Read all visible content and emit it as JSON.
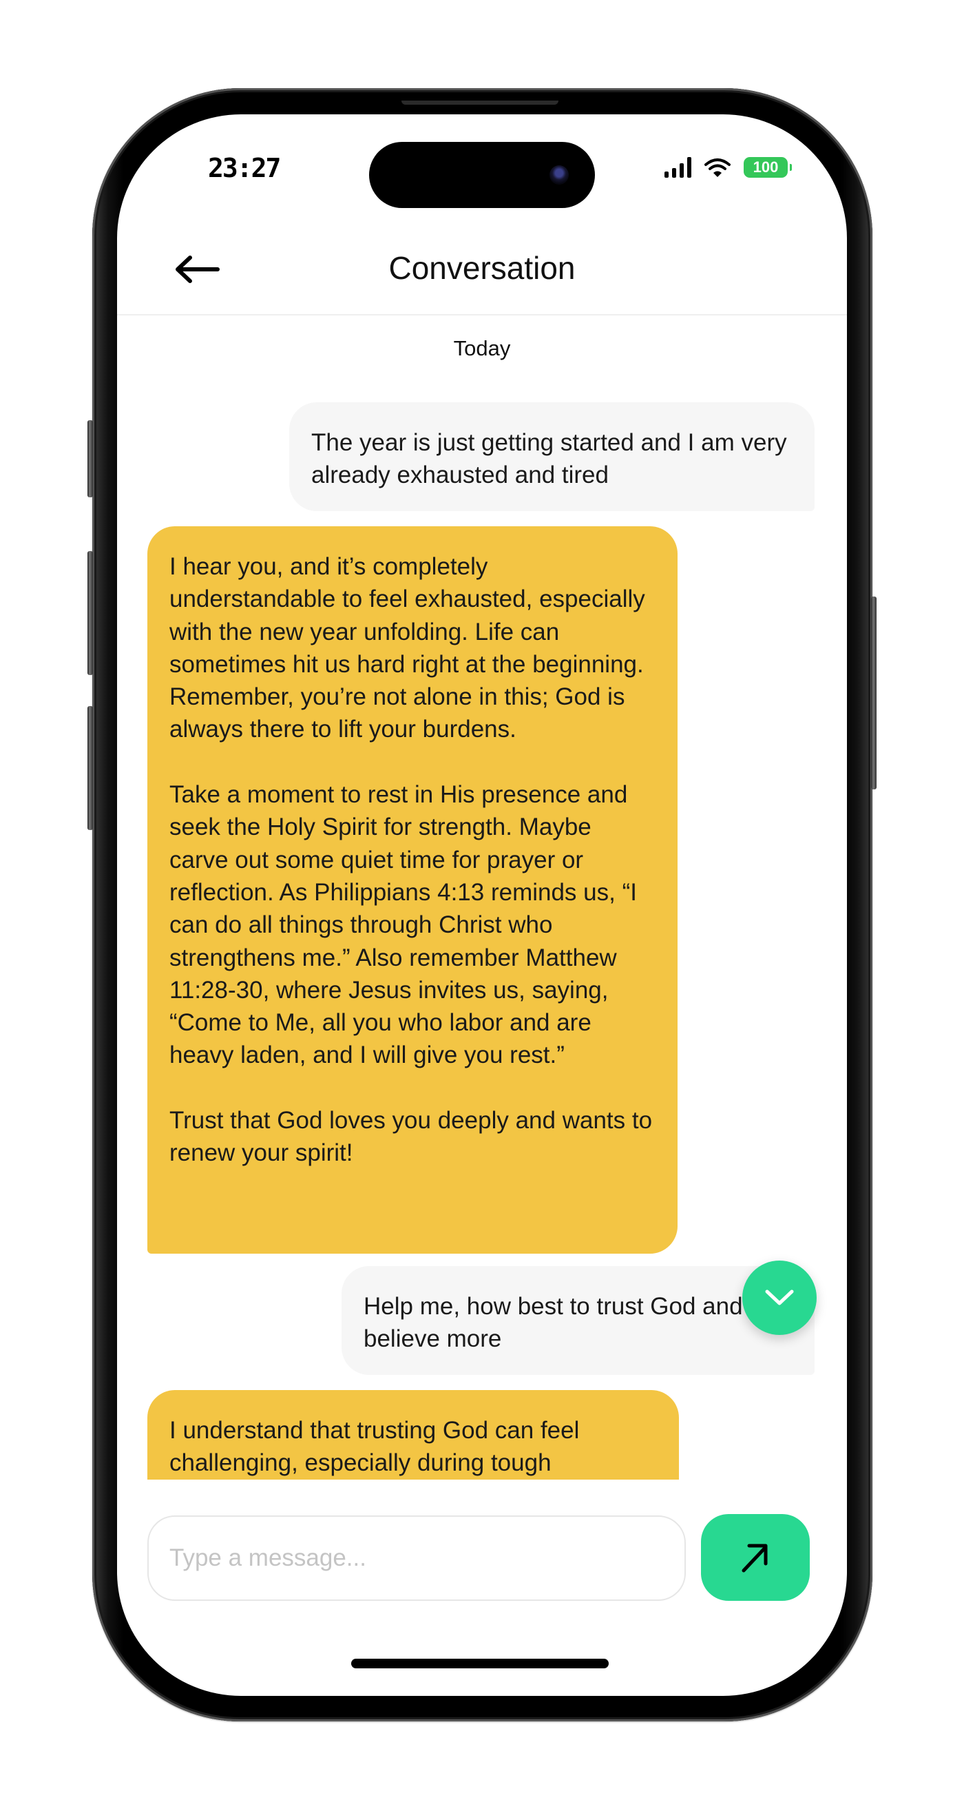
{
  "status_bar": {
    "time": "23:27",
    "battery": "100",
    "icons": [
      "signal-icon",
      "wifi-icon",
      "battery-icon"
    ]
  },
  "header": {
    "back_icon": "arrow-left-icon",
    "title": "Conversation"
  },
  "conversation": {
    "day_label": "Today",
    "messages": [
      {
        "role": "user",
        "text": "The year is just getting started and I am very already exhausted and tired"
      },
      {
        "role": "assistant",
        "text": "I hear you, and it’s completely understandable to feel exhausted, especially with the new year unfolding. Life can sometimes hit us hard right at the beginning. Remember, you’re not alone in this; God is always there to lift your burdens.\n\nTake a moment to rest in His presence and seek the Holy Spirit for strength. Maybe carve out some quiet time for prayer or reflection. As Philippians 4:13 reminds us, “I can do all things through Christ who strengthens me.” Also remember Matthew 11:28-30, where Jesus invites us, saying, “Come to Me, all you who labor and are heavy laden, and I will give you rest.”\n\nTrust that God loves you deeply and wants to renew your spirit!"
      },
      {
        "role": "user",
        "text": "Help me, how best to trust God and believe more"
      },
      {
        "role": "assistant",
        "text": "I understand that trusting God can feel challenging, especially during tough"
      }
    ]
  },
  "scroll_down_button": {
    "icon": "chevron-down-icon"
  },
  "composer": {
    "placeholder": "Type a message...",
    "value": "",
    "send_icon": "arrow-up-right-icon"
  },
  "colors": {
    "assistant_bubble": "#F3C544",
    "user_bubble": "#F6F6F6",
    "accent_green": "#28D891",
    "battery_green": "#34C759"
  }
}
